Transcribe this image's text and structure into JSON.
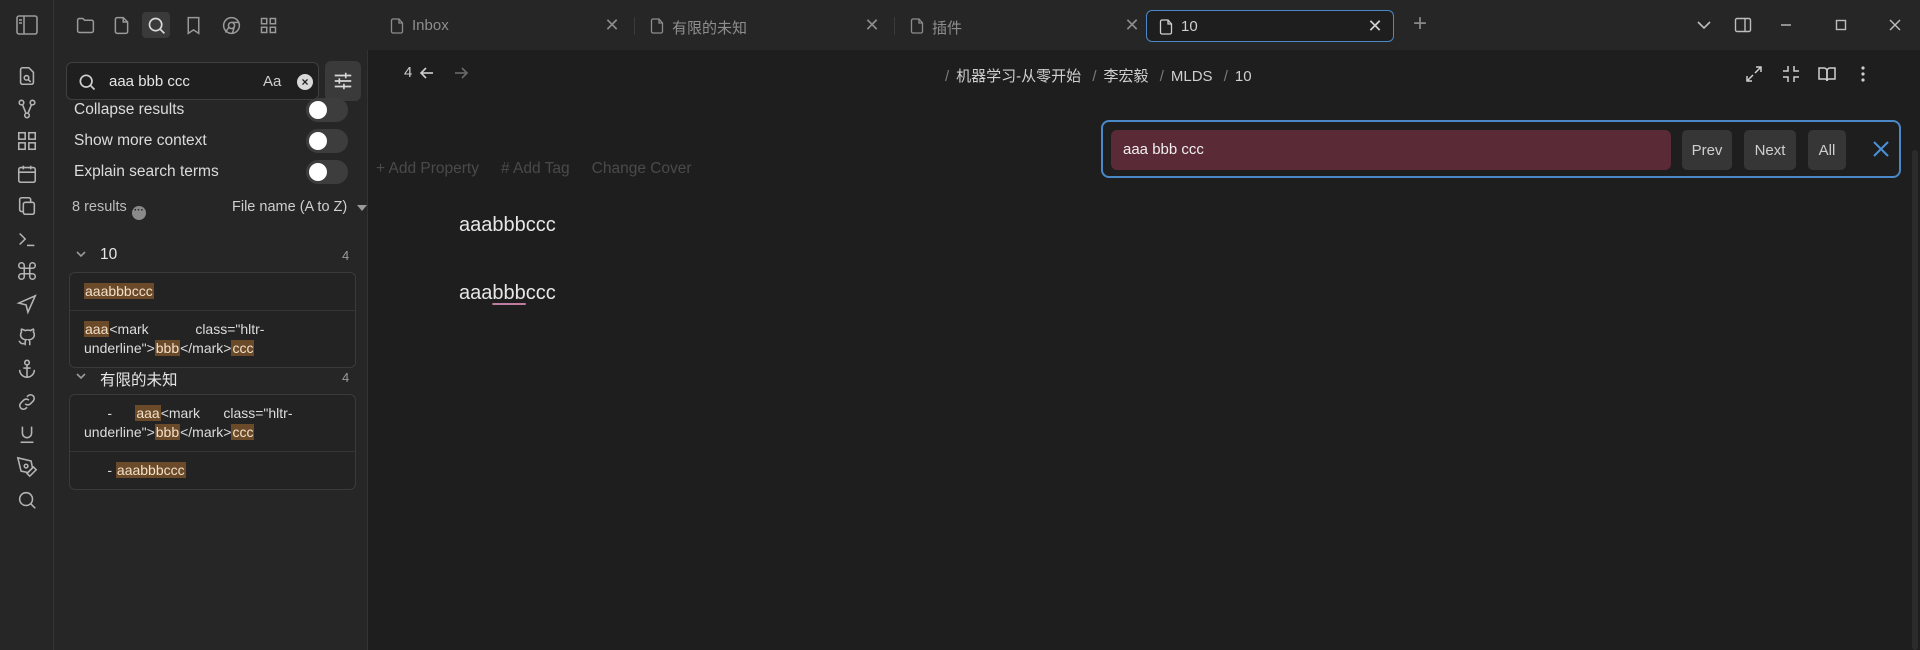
{
  "sidebar": {
    "search": {
      "value": "aaa bbb ccc",
      "case_label": "Aa",
      "clear_icon": "×"
    },
    "options": [
      {
        "label": "Collapse results",
        "enabled": false
      },
      {
        "label": "Show more context",
        "enabled": false
      },
      {
        "label": "Explain search terms",
        "enabled": false
      }
    ],
    "results_count": "8 results",
    "sort_label": "File name (A to Z)",
    "groups": [
      {
        "title": "10",
        "count": "4",
        "matches": [
          {
            "parts": [
              [
                "aaabbbccc",
                true
              ]
            ]
          },
          {
            "parts": [
              [
                "aaa",
                true
              ],
              [
                "<mark            class=\"hltr-underline\">",
                false
              ],
              [
                "bbb",
                true
              ],
              [
                "</mark>",
                false
              ],
              [
                "ccc",
                true
              ]
            ]
          }
        ]
      },
      {
        "title": "有限的未知",
        "count": "4",
        "matches": [
          {
            "parts": [
              [
                "      -      ",
                false
              ],
              [
                "aaa",
                true
              ],
              [
                "<mark      class=\"hltr-underline\">",
                false
              ],
              [
                "bbb",
                true
              ],
              [
                "</mark>",
                false
              ],
              [
                "ccc",
                true
              ]
            ]
          },
          {
            "parts": [
              [
                "      - ",
                false
              ],
              [
                "aaabbbccc",
                true
              ]
            ]
          }
        ]
      }
    ]
  },
  "tabs": [
    {
      "label": "Inbox",
      "active": false
    },
    {
      "label": "有限的未知",
      "active": false
    },
    {
      "label": "插件",
      "active": false
    },
    {
      "label": "10",
      "active": true
    }
  ],
  "editor": {
    "nav_num": "4",
    "breadcrumbs": [
      "机器学习-从零开始",
      "李宏毅",
      "MLDS",
      "10"
    ],
    "props": {
      "add_property": "+ Add Property",
      "add_tag": "# Add Tag",
      "change_cover": "Change Cover"
    },
    "lines": {
      "line1": "aaabbbccc",
      "line2_a": "aaa",
      "line2_b": "bbb",
      "line2_c": "ccc"
    }
  },
  "findbar": {
    "query": "aaa bbb ccc",
    "prev_label": "Prev",
    "next_label": "Next",
    "all_label": "All"
  },
  "colors": {
    "accent": "#4a88c7",
    "highlight": "#6b4a2a",
    "find_bg": "#5a2a36"
  }
}
